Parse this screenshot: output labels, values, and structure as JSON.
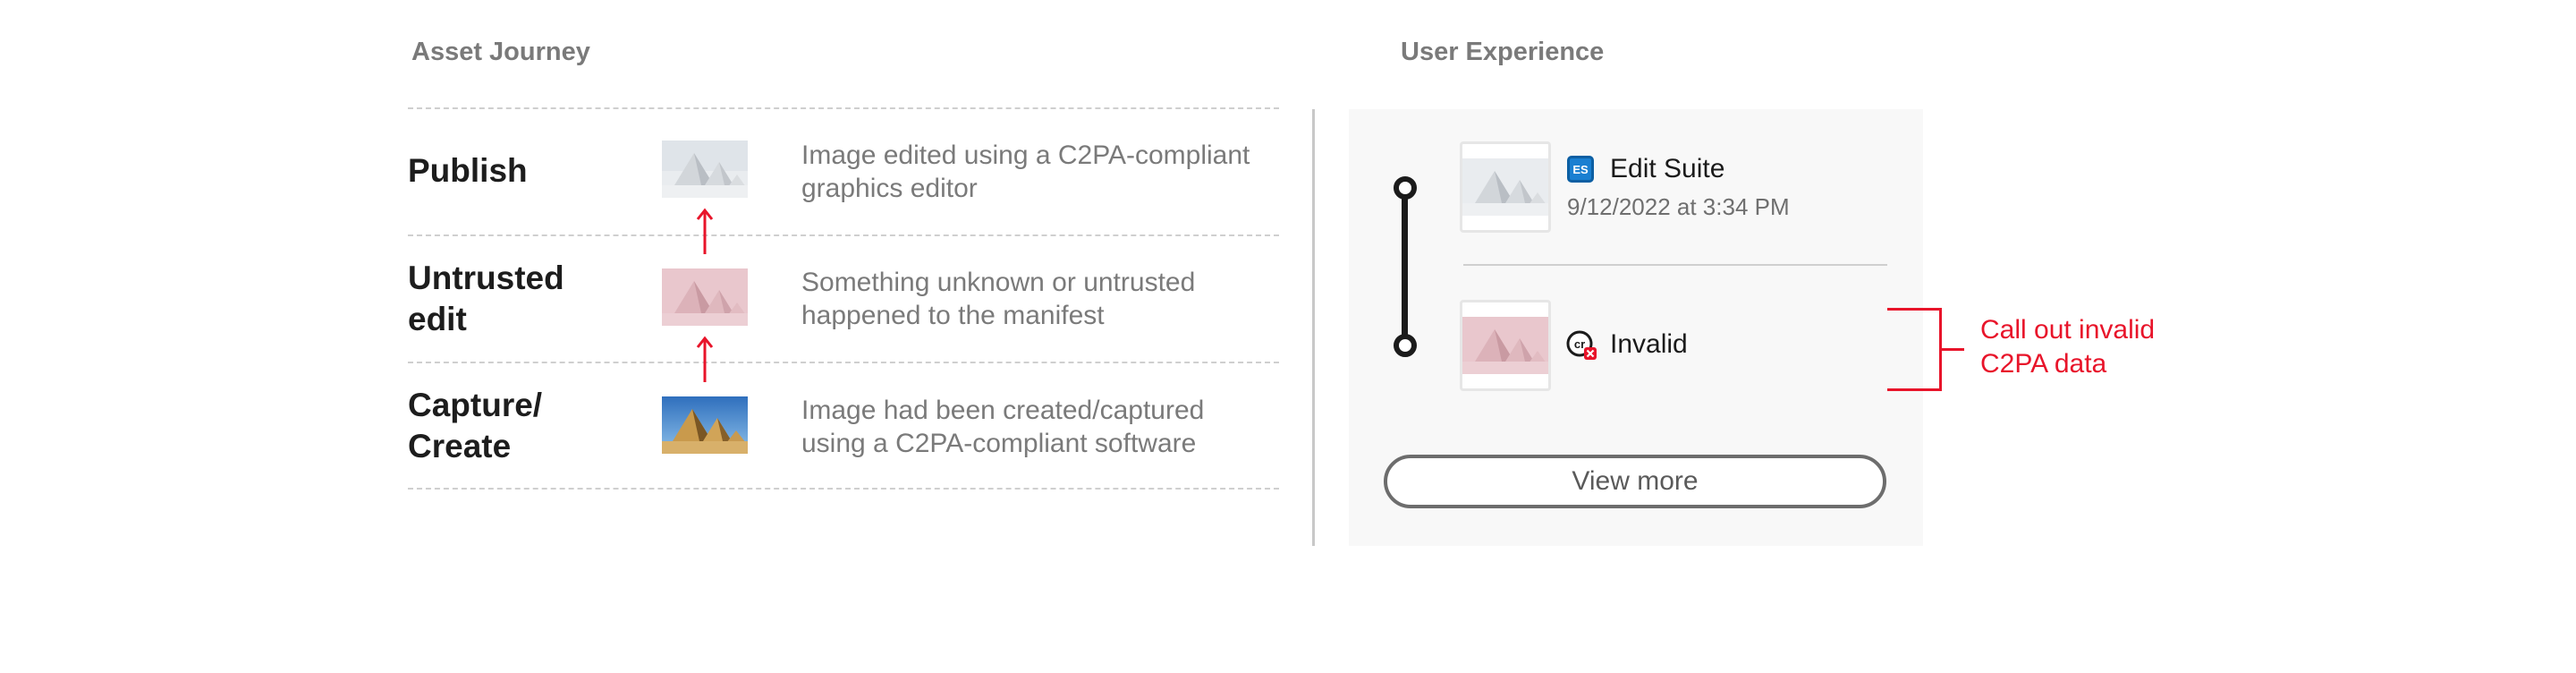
{
  "asset_journey": {
    "title": "Asset Journey",
    "stages": [
      {
        "label_lines": [
          "Publish"
        ],
        "description_lines": [
          "Image edited using a C2PA-compliant",
          "graphics editor"
        ],
        "thumbnail": "faded-pyramids-image"
      },
      {
        "label_lines": [
          "Untrusted",
          "edit"
        ],
        "description_lines": [
          "Something unknown or untrusted",
          "happened to the manifest"
        ],
        "thumbnail": "pink-pyramids-image"
      },
      {
        "label_lines": [
          "Capture/",
          "Create"
        ],
        "description_lines": [
          "Image had been created/captured",
          "using a C2PA-compliant software"
        ],
        "thumbnail": "original-pyramids-image"
      }
    ]
  },
  "user_experience": {
    "title": "User Experience",
    "entries": [
      {
        "icon": "edit-suite-icon",
        "icon_text": "ES",
        "name": "Edit Suite",
        "date": "9/12/2022 at 3:34 PM"
      },
      {
        "icon": "content-credentials-invalid-icon",
        "icon_text": "cr",
        "name": "Invalid"
      }
    ],
    "view_more_label": "View more"
  },
  "callout": {
    "lines": [
      "Call out invalid",
      "C2PA data"
    ]
  },
  "colors": {
    "accent_red": "#e8142a",
    "es_blue": "#1a7fd1",
    "panel_bg": "#f8f8f8"
  }
}
